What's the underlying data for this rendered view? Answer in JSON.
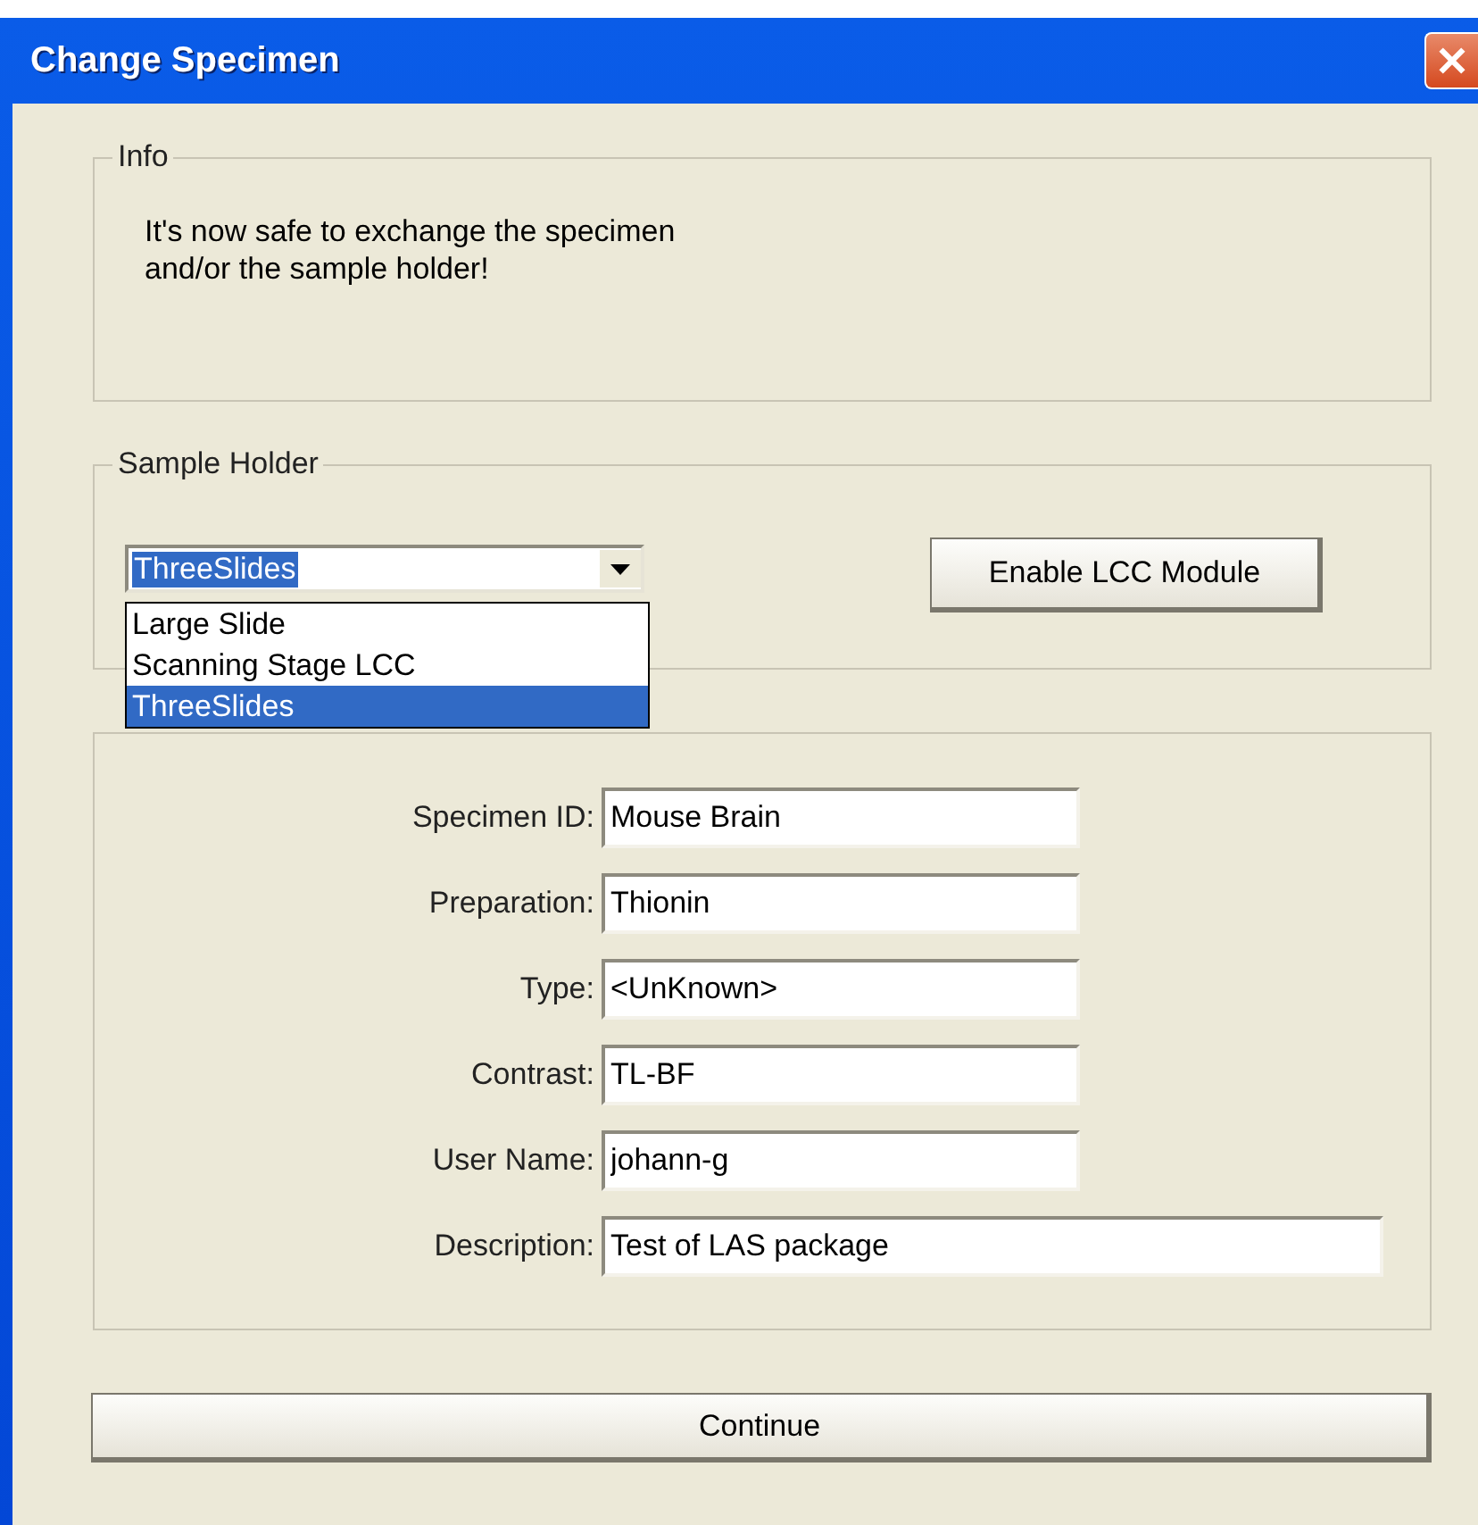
{
  "window": {
    "title": "Change Specimen"
  },
  "info": {
    "legend": "Info",
    "message_lines": [
      "It's now safe to exchange the specimen",
      "and/or the sample holder!"
    ]
  },
  "sample_holder": {
    "legend": "Sample Holder",
    "combo": {
      "value": "ThreeSlides",
      "expanded": true
    },
    "options": [
      {
        "label": "Large Slide",
        "selected": false
      },
      {
        "label": "Scanning Stage LCC",
        "selected": false
      },
      {
        "label": "ThreeSlides",
        "selected": true
      }
    ],
    "button": "Enable LCC Module"
  },
  "fields": [
    {
      "label": "Specimen ID:",
      "value": "Mouse Brain",
      "kind": "short"
    },
    {
      "label": "Preparation:",
      "value": "Thionin",
      "kind": "short"
    },
    {
      "label": "Type:",
      "value": "<UnKnown>",
      "kind": "short"
    },
    {
      "label": "Contrast:",
      "value": "TL-BF",
      "kind": "short"
    },
    {
      "label": "User Name:",
      "value": "johann-g",
      "kind": "short"
    },
    {
      "label": "Description:",
      "value": "Test of LAS package",
      "kind": "long"
    }
  ],
  "buttons": [
    "Continue"
  ]
}
